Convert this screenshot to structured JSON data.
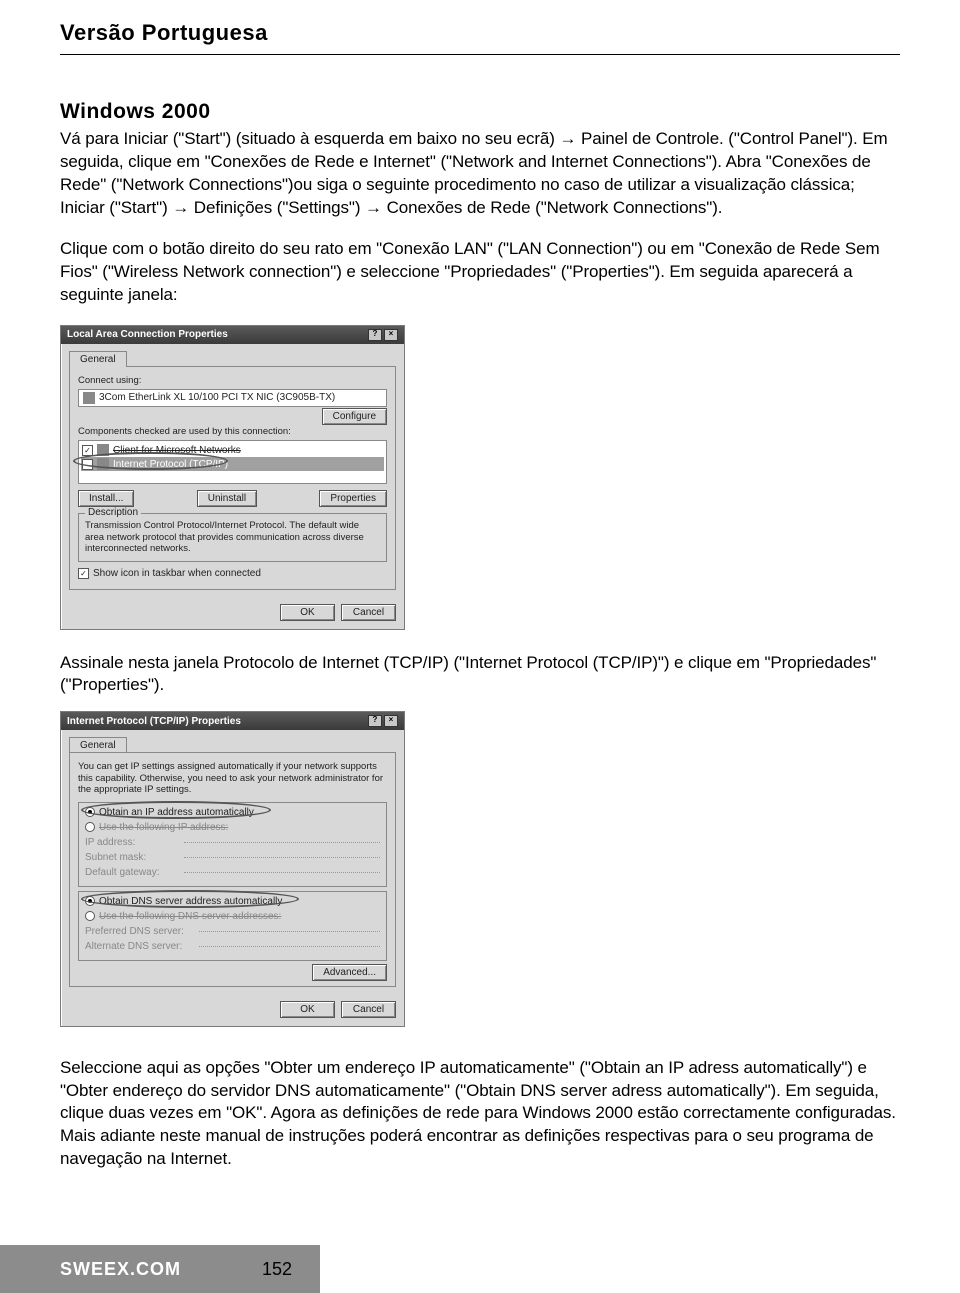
{
  "header": {
    "title": "Versão Portuguesa"
  },
  "section": {
    "heading": "Windows 2000"
  },
  "paras": {
    "p1": "Vá para Iniciar (\"Start\") (situado à esquerda em baixo no seu ecrã) → Painel de Controle. (\"Control Panel\"). Em seguida, clique em \"Conexões de Rede e Internet\" (\"Network and Internet Connections\"). Abra \"Conexões de Rede\" (\"Network Connections\")ou siga o seguinte procedimento no caso de utilizar a visualização clássica;",
    "p1b": "Iniciar (\"Start\") → Definições (\"Settings\") → Conexões de Rede (\"Network Connections\").",
    "p2": "Clique com o botão direito do seu rato em \"Conexão LAN\" (\"LAN Connection\") ou em \"Conexão de Rede Sem Fios\" (\"Wireless Network connection\") e seleccione \"Propriedades\" (\"Properties\"). Em seguida aparecerá a seguinte janela:",
    "p3": "Assinale nesta janela Protocolo de Internet (TCP/IP) (\"Internet Protocol (TCP/IP)\") e clique em \"Propriedades\" (\"Properties\").",
    "p4": "Seleccione aqui as opções \"Obter um endereço IP automaticamente\" (\"Obtain an IP adress automatically\") e \"Obter endereço do servidor DNS automaticamente\" (\"Obtain DNS server adress automatically\"). Em seguida, clique duas vezes em \"OK\". Agora as definições de rede para Windows 2000 estão correctamente configuradas. Mais adiante neste manual de instruções poderá encontrar as definições respectivas para o seu programa de navegação na Internet."
  },
  "win1": {
    "title": "Local Area Connection Properties",
    "tab": "General",
    "connect_using": "Connect using:",
    "adapter": "3Com EtherLink XL 10/100 PCI TX NIC (3C905B-TX)",
    "configure": "Configure",
    "components_label": "Components checked are used by this connection:",
    "item1": "Client for Microsoft Networks",
    "item2": "Internet Protocol (TCP/IP)",
    "install": "Install...",
    "uninstall": "Uninstall",
    "properties": "Properties",
    "desc_legend": "Description",
    "desc_text": "Transmission Control Protocol/Internet Protocol. The default wide area network protocol that provides communication across diverse interconnected networks.",
    "show_icon": "Show icon in taskbar when connected",
    "ok": "OK",
    "cancel": "Cancel"
  },
  "win2": {
    "title": "Internet Protocol (TCP/IP) Properties",
    "tab": "General",
    "intro": "You can get IP settings assigned automatically if your network supports this capability. Otherwise, you need to ask your network administrator for the appropriate IP settings.",
    "r1": "Obtain an IP address automatically",
    "r2": "Use the following IP address:",
    "ip": "IP address:",
    "mask": "Subnet mask:",
    "gw": "Default gateway:",
    "r3": "Obtain DNS server address automatically",
    "r4": "Use the following DNS server addresses:",
    "pdns": "Preferred DNS server:",
    "adns": "Alternate DNS server:",
    "adv": "Advanced...",
    "ok": "OK",
    "cancel": "Cancel"
  },
  "footer": {
    "site": "SWEEX.COM",
    "page": "152"
  }
}
